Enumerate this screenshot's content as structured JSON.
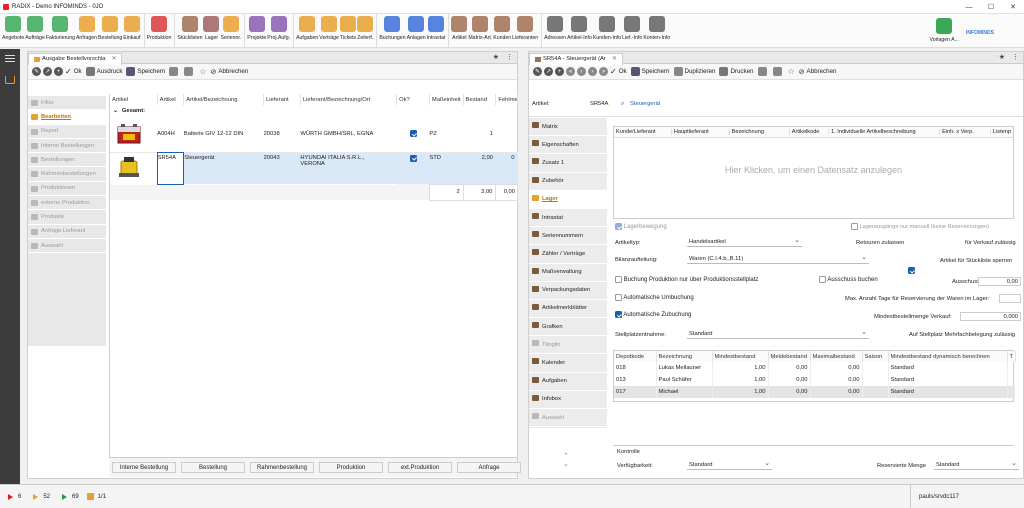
{
  "window": {
    "title": "RADIX - Demo INFOMINDS - 0JO",
    "controls": [
      "—",
      "☐",
      "✕"
    ]
  },
  "ribbon": [
    {
      "label": "Angebote",
      "icon": "offer-icon",
      "color": "#3aa858"
    },
    {
      "label": "Aufträge",
      "icon": "order-icon",
      "color": "#3aa858"
    },
    {
      "label": "Fakturierung",
      "icon": "invoice-icon",
      "color": "#3aa858"
    },
    {
      "label": "Anfragen",
      "icon": "inquiry-icon",
      "color": "#e8a030"
    },
    {
      "label": "Bestellung",
      "icon": "cart-icon",
      "color": "#e8a030"
    },
    {
      "label": "Einkauf",
      "icon": "purchase-icon",
      "color": "#e8a030"
    },
    {
      "label": "Produktion",
      "icon": "gear-icon",
      "color": "#d83a3a"
    },
    {
      "label": "Stücklisten",
      "icon": "bom-icon",
      "color": "#a07050"
    },
    {
      "label": "Lager",
      "icon": "warehouse-icon",
      "color": "#a06060"
    },
    {
      "label": "Seriennr.",
      "icon": "serial-icon",
      "color": "#e8a030"
    },
    {
      "label": "Projekte",
      "icon": "project-icon",
      "color": "#8a5ab0"
    },
    {
      "label": "Proj.Aufg.",
      "icon": "project-task-icon",
      "color": "#8a5ab0"
    },
    {
      "label": "Aufgaben",
      "icon": "task-icon",
      "color": "#e8a030"
    },
    {
      "label": "Verträge",
      "icon": "contract-icon",
      "color": "#e8a030"
    },
    {
      "label": "Tickets",
      "icon": "ticket-icon",
      "color": "#e8a030"
    },
    {
      "label": "Zeiterf.",
      "icon": "time-icon",
      "color": "#e8a030"
    },
    {
      "label": "Buchungen",
      "icon": "booking-icon",
      "color": "#3a6fd8"
    },
    {
      "label": "Anlagen",
      "icon": "asset-icon",
      "color": "#3a6fd8"
    },
    {
      "label": "Intrastat",
      "icon": "intrastat-icon",
      "color": "#3a6fd8"
    },
    {
      "label": "Artikel",
      "icon": "article-icon",
      "color": "#a07050"
    },
    {
      "label": "Matrix-Art.",
      "icon": "matrix-icon",
      "color": "#a07050"
    },
    {
      "label": "Kunden",
      "icon": "customer-icon",
      "color": "#a07050"
    },
    {
      "label": "Lieferanten",
      "icon": "supplier-icon",
      "color": "#a07050"
    },
    {
      "label": "Adressen",
      "icon": "address-icon",
      "color": "#606060"
    },
    {
      "label": "Artikel-Info",
      "icon": "article-info-icon",
      "color": "#606060"
    },
    {
      "label": "Kunden-Info",
      "icon": "customer-info-icon",
      "color": "#606060"
    },
    {
      "label": "Lief.-Info",
      "icon": "supplier-info-icon",
      "color": "#606060"
    },
    {
      "label": "Konten-Info",
      "icon": "account-info-icon",
      "color": "#606060"
    }
  ],
  "ribbon_right": {
    "label": "Vorlagen A...",
    "logo": "INFOMINDS"
  },
  "left_panel": {
    "tab_title": "Ausgabe Bestellvorschla",
    "toolbar": {
      "ok": "Ok",
      "print": "Ausdruck",
      "save": "Speichern",
      "cancel": "Abbrechen"
    },
    "nav": [
      "Filter",
      "Bearbeiten",
      "Report",
      "Interne Bestellungen",
      "Bestellungen",
      "Rahmenbestellungen",
      "Produktionen",
      "externe Produktion",
      "Produkte",
      "Anfrage Lieferant",
      "Auswahl"
    ],
    "columns": [
      "Artikel",
      "Artikel",
      "Artikel/Bezeichnung",
      "Lieferant",
      "Lieferant/Bezeichnung/Ort",
      "Ok?",
      "Maßeinheit",
      "Bestand",
      "Fehlmeng"
    ],
    "group_label": "Gesamt:",
    "rows": [
      {
        "code": "A004H",
        "name": "Batterie GIV 12-12 DIN",
        "supplier": "20038",
        "supplier_name": "WÜRTH GMBH/SRL, EGNA",
        "supplier_name2": "",
        "unit": "PZ",
        "stock": "1",
        "extra": ""
      },
      {
        "code": "SR54A",
        "name": "Steuergerät",
        "supplier": "20043",
        "supplier_name": "HYUNDAI ITALIA S.R.L.,",
        "supplier_name2": "VERONA",
        "unit": "STD",
        "stock": "2,00",
        "extra": "0"
      }
    ],
    "totals": {
      "count": "2",
      "stock": "3,00",
      "extra": "0,00"
    },
    "bottom_buttons": [
      "Interne Bestellung",
      "Bestellung",
      "Rahmenbestellung",
      "Produktion",
      "ext.Produktion",
      "Anfrage"
    ]
  },
  "right_panel": {
    "tab_title": "SR54A - Steuergerät (Ar",
    "toolbar": {
      "ok": "Ok",
      "save": "Speichern",
      "duplicate": "Duplizieren",
      "print": "Drucken",
      "cancel": "Abbrechen"
    },
    "article_label": "Artikel:",
    "article_code": "SR54A",
    "article_name": "Steuergerät",
    "nav": [
      "Matrix",
      "Eigenschaften",
      "Zusatz 1",
      "Zubehör",
      "Lager",
      "Intrastat",
      "Seriennummern",
      "Zähler / Verträge",
      "Maßverwaltung",
      "Verpackungsdaten",
      "Artikelmerkblätter",
      "Grafken",
      "Titoglio",
      "Kalender",
      "Aufgaben",
      "Infobox",
      "Auswahl"
    ],
    "supplier_grid_cols": [
      "Kunde/Lieferant",
      "Hauptlieferant",
      "Bezeichnung",
      "Artikelkode",
      "1. Individuelle Artikelbeschreibung",
      "Einh. x Verp.",
      "Listenp"
    ],
    "empty_hint": "Hier Klicken, um einen Datensatz anzulegen",
    "lagerbewegung": "Lagerbewegung",
    "lager_manual": "Lagerausgänge nur manuell (keine Reservierungen)",
    "artikeltyp_label": "Artikeltyp:",
    "artikeltyp": "Handelsartikel",
    "retouren": "Retouren zulassen",
    "verkauf": "für Verkauf zulässig",
    "bilanz_label": "Bilanzaufteilung:",
    "bilanz": "Waren (C.I.4.b.,B.11)",
    "stueckliste_sperren": "Artikel für Stückliste sperren",
    "buchung_prod": "Buchung Produktion nur über Produktionsstellplatz",
    "ausschuss_buchen": "Ausschuss buchen",
    "ausschuss_label": "Ausschuss:",
    "ausschuss_value": "0,00",
    "auto_umbuchung": "Automatische Umbuchung",
    "max_tage": "Max. Anzahl Tage für Reservierung der Waren im Lager:",
    "auto_zubuchung": "Automatische Zubuchung",
    "mindest_verkauf": "Mindestbestellmenge Verkauf:",
    "mindest_verkauf_value": "0,000",
    "stellplatz_label": "Stellplatzentnahme:",
    "stellplatz": "Standard",
    "mehrfach": "Auf Stellplatz Mehrfachbelegung zulässig",
    "depot_cols": [
      "Depotkode",
      "Bezeichnung",
      "Mindestbestand",
      "Meldebestand",
      "Maximalbestand",
      "Saison",
      "Mindestbestand dynamisch berechnen",
      "T"
    ],
    "depots": [
      {
        "code": "018",
        "name": "Lukas Mellauner",
        "min": "1,00",
        "meld": "0,00",
        "max": "0,00",
        "saison": "",
        "dyn": "Standard"
      },
      {
        "code": "013",
        "name": "Paul Schäfer",
        "min": "1,00",
        "meld": "0,00",
        "max": "0,00",
        "saison": "",
        "dyn": "Standard"
      },
      {
        "code": "017",
        "name": "Michael",
        "min": "1,00",
        "meld": "0,00",
        "max": "0,00",
        "saison": "",
        "dyn": "Standard"
      }
    ],
    "kontrolle": "Kontrolle",
    "verfuegbarkeit_label": "Verfügbarkeit:",
    "verfuegbarkeit": "Standard",
    "reserviert_label": "Reservierte Menge",
    "reserviert": "Standard"
  },
  "status": {
    "red": "6",
    "yellow": "52",
    "green": "69",
    "pages": "1/1",
    "user": "pauls/srvdc117"
  }
}
